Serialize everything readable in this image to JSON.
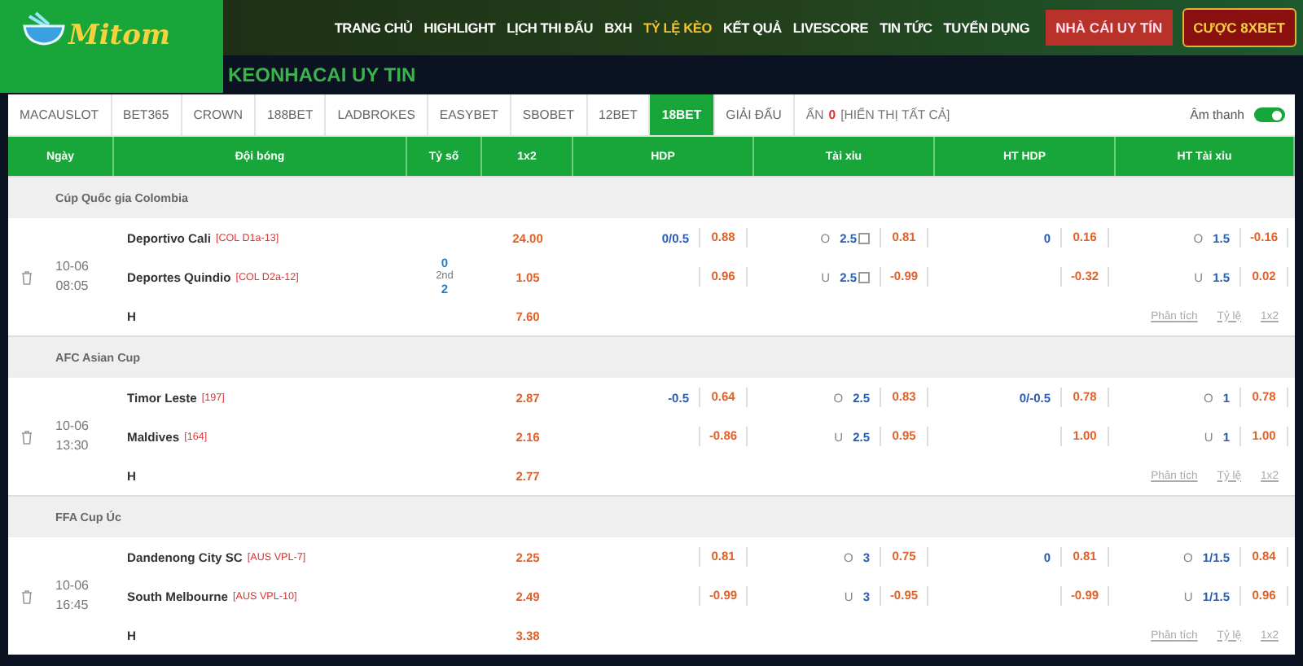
{
  "logo": {
    "text": "Mitom"
  },
  "nav": [
    {
      "label": "TRANG CHỦ",
      "selected": false
    },
    {
      "label": "HIGHLIGHT",
      "selected": false
    },
    {
      "label": "LỊCH THI ĐẤU",
      "selected": false
    },
    {
      "label": "BXH",
      "selected": false
    },
    {
      "label": "TỶ LỆ KÈO",
      "selected": true
    },
    {
      "label": "KẾT QUẢ",
      "selected": false
    },
    {
      "label": "LIVESCORE",
      "selected": false
    },
    {
      "label": "TIN TỨC",
      "selected": false
    },
    {
      "label": "TUYỂN DỤNG",
      "selected": false
    }
  ],
  "header_buttons": [
    {
      "label": "NHÀ CÁI UY TÍN",
      "kind": "red"
    },
    {
      "label": "CƯỢC 8XBET",
      "kind": "gold"
    }
  ],
  "page_title": "KEONHACAI UY TIN",
  "tabs": [
    {
      "label": "MACAUSLOT",
      "selected": false
    },
    {
      "label": "BET365",
      "selected": false
    },
    {
      "label": "CROWN",
      "selected": false
    },
    {
      "label": "188BET",
      "selected": false
    },
    {
      "label": "LADBROKES",
      "selected": false
    },
    {
      "label": "EASYBET",
      "selected": false
    },
    {
      "label": "SBOBET",
      "selected": false
    },
    {
      "label": "12BET",
      "selected": false
    },
    {
      "label": "18BET",
      "selected": true
    },
    {
      "label": "GIẢI ĐẤU",
      "selected": false
    }
  ],
  "hidden": {
    "label": "ẨN",
    "count": "0",
    "link": "[HIỂN THỊ TẤT CẢ]"
  },
  "sound": {
    "label": "Âm thanh",
    "on": true
  },
  "columns": [
    "Ngày",
    "Đội bóng",
    "Tỷ số",
    "1x2",
    "HDP",
    "Tài xỉu",
    "HT HDP",
    "HT Tài xỉu"
  ],
  "leagues": [
    {
      "name": "Cúp Quốc gia Colombia",
      "matches": [
        {
          "date": "10-06",
          "time": "08:05",
          "home": {
            "name": "Deportivo Cali",
            "tag": "[COL D1a-13]"
          },
          "away": {
            "name": "Deportes Quindio",
            "tag": "[COL D2a-12]"
          },
          "draw": "H",
          "score": {
            "home": "0",
            "status": "2nd",
            "away": "2"
          },
          "x12": [
            "24.00",
            "1.05",
            "7.60"
          ],
          "hdp": [
            {
              "line": "0/0.5",
              "odds": "0.88"
            },
            {
              "odds": "0.96"
            }
          ],
          "ou": [
            {
              "side": "O",
              "line": "2.5",
              "odds": "0.81",
              "note": true
            },
            {
              "side": "U",
              "line": "2.5",
              "odds": "-0.99",
              "note": true
            }
          ],
          "ht_hdp": [
            {
              "line": "0",
              "odds": "0.16"
            },
            {
              "odds": "-0.32"
            }
          ],
          "ht_ou": [
            {
              "side": "O",
              "line": "1.5",
              "odds": "-0.16",
              "note": false
            },
            {
              "side": "U",
              "line": "1.5",
              "odds": "0.02",
              "note": false
            }
          ],
          "links": [
            "Phân tích",
            "Tỷ lệ",
            "1x2"
          ]
        }
      ]
    },
    {
      "name": "AFC Asian Cup",
      "matches": [
        {
          "date": "10-06",
          "time": "13:30",
          "home": {
            "name": "Timor Leste",
            "tag": "[197]"
          },
          "away": {
            "name": "Maldives",
            "tag": "[164]"
          },
          "draw": "H",
          "x12": [
            "2.87",
            "2.16",
            "2.77"
          ],
          "hdp": [
            {
              "line": "-0.5",
              "odds": "0.64"
            },
            {
              "odds": "-0.86"
            }
          ],
          "ou": [
            {
              "side": "O",
              "line": "2.5",
              "odds": "0.83",
              "note": false
            },
            {
              "side": "U",
              "line": "2.5",
              "odds": "0.95",
              "note": false
            }
          ],
          "ht_hdp": [
            {
              "line": "0/-0.5",
              "odds": "0.78"
            },
            {
              "odds": "1.00"
            }
          ],
          "ht_ou": [
            {
              "side": "O",
              "line": "1",
              "odds": "0.78",
              "note": false
            },
            {
              "side": "U",
              "line": "1",
              "odds": "1.00",
              "note": false
            }
          ],
          "links": [
            "Phân tích",
            "Tỷ lệ",
            "1x2"
          ]
        }
      ]
    },
    {
      "name": "FFA Cup Úc",
      "matches": [
        {
          "date": "10-06",
          "time": "16:45",
          "home": {
            "name": "Dandenong City SC",
            "tag": "[AUS VPL-7]"
          },
          "away": {
            "name": "South Melbourne",
            "tag": "[AUS VPL-10]"
          },
          "draw": "H",
          "x12": [
            "2.25",
            "2.49",
            "3.38"
          ],
          "hdp": [
            {
              "odds": "0.81"
            },
            {
              "odds": "-0.99"
            }
          ],
          "ou": [
            {
              "side": "O",
              "line": "3",
              "odds": "0.75",
              "note": false
            },
            {
              "side": "U",
              "line": "3",
              "odds": "-0.95",
              "note": false
            }
          ],
          "ht_hdp": [
            {
              "line": "0",
              "odds": "0.81"
            },
            {
              "odds": "-0.99"
            }
          ],
          "ht_ou": [
            {
              "side": "O",
              "line": "1/1.5",
              "odds": "0.84",
              "note": false
            },
            {
              "side": "U",
              "line": "1/1.5",
              "odds": "0.96",
              "note": false
            }
          ],
          "links": [
            "Phân tích",
            "Tỷ lệ",
            "1x2"
          ]
        }
      ]
    }
  ]
}
